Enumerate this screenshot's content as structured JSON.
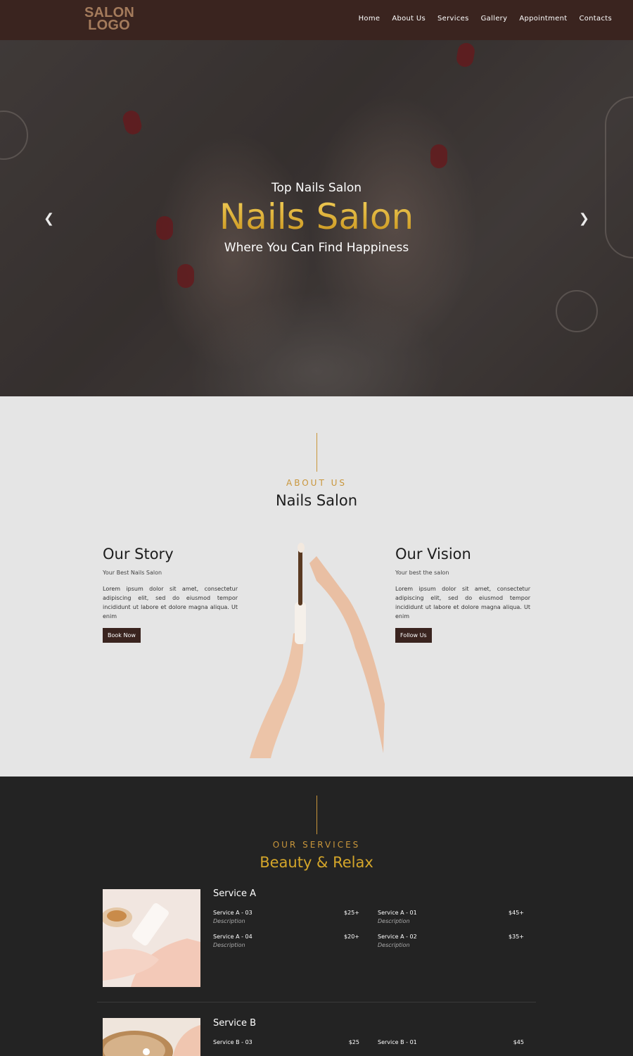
{
  "nav": {
    "logo_line1": "SALON",
    "logo_line2": "LOGO",
    "items": [
      "Home",
      "About Us",
      "Services",
      "Gallery",
      "Appointment",
      "Contacts"
    ]
  },
  "hero": {
    "subtitle": "Top Nails Salon",
    "title": "Nails Salon",
    "tagline": "Where You Can Find Happiness",
    "prev_icon": "chevron-left-icon",
    "next_icon": "chevron-right-icon"
  },
  "about": {
    "eyebrow": "ABOUT US",
    "title": "Nails Salon",
    "story": {
      "heading": "Our Story",
      "subheading": "Your Best Nails Salon",
      "body": "Lorem ipsum dolor sit amet, consectetur adipiscing elit, sed do eiusmod tempor incididunt ut labore et dolore magna aliqua. Ut enim",
      "button": "Book Now"
    },
    "vision": {
      "heading": "Our Vision",
      "subheading": "Your best the salon",
      "body": "Lorem ipsum dolor sit amet, consectetur adipiscing elit, sed do eiusmod tempor incididunt ut labore et dolore magna aliqua. Ut enim",
      "button": "Follow Us"
    }
  },
  "services": {
    "eyebrow": "OUR SERVICES",
    "title": "Beauty & Relax",
    "groups": [
      {
        "name": "Service A",
        "items": [
          {
            "name": "Service A - 03",
            "price": "$25+",
            "desc": "Description"
          },
          {
            "name": "Service A - 01",
            "price": "$45+",
            "desc": "Description"
          },
          {
            "name": "Service A - 04",
            "price": "$20+",
            "desc": "Description"
          },
          {
            "name": "Service A - 02",
            "price": "$35+",
            "desc": "Description"
          }
        ]
      },
      {
        "name": "Service B",
        "items": [
          {
            "name": "Service B - 03",
            "price": "$25"
          },
          {
            "name": "Service B - 01",
            "price": "$45"
          }
        ]
      }
    ]
  },
  "colors": {
    "nav_bg": "#3a241f",
    "gold": "#c9963b",
    "about_bg": "#e5e5e5",
    "services_bg": "#232323",
    "button_bg": "#3a241f"
  }
}
